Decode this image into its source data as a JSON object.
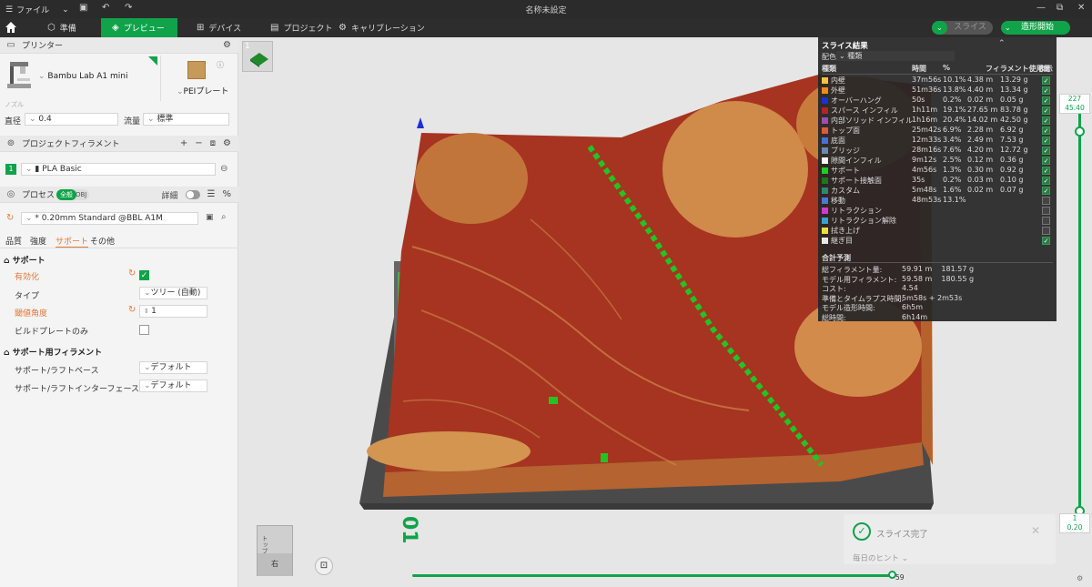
{
  "titlebar": {
    "file_menu": "ファイル",
    "title": "名称未設定"
  },
  "tabs": [
    {
      "label": "準備"
    },
    {
      "label": "プレビュー"
    },
    {
      "label": "デバイス"
    },
    {
      "label": "プロジェクト"
    },
    {
      "label": "キャリブレーション"
    }
  ],
  "actions": {
    "slice": "スライス",
    "print": "造形開始"
  },
  "printer": {
    "section": "プリンター",
    "name": "Bambu Lab A1 mini",
    "plate": "PEIプレート",
    "nozzle_label": "ノズル",
    "diameter_label": "直径",
    "diameter_value": "0.4",
    "flow_label": "流量",
    "flow_value": "標準"
  },
  "filament": {
    "section": "プロジェクトフィラメント",
    "index": "1",
    "name": "PLA Basic"
  },
  "process": {
    "section": "プロセス",
    "toggle_all": "全般",
    "toggle_obj": "OBJ",
    "detail_label": "詳細",
    "profile": "* 0.20mm Standard @BBL A1M",
    "subtabs": [
      "品質",
      "強度",
      "サポート",
      "その他"
    ]
  },
  "support": {
    "group": "サポート",
    "enable_label": "有効化",
    "type_label": "タイプ",
    "type_value": "ツリー (自動)",
    "threshold_label": "閾値角度",
    "threshold_value": "1",
    "buildplate_label": "ビルドプレートのみ",
    "filament_group": "サポート用フィラメント",
    "base_label": "サポート/ラフトベース",
    "base_value": "デフォルト",
    "interface_label": "サポート/ラフトインターフェース",
    "interface_value": "デフォルト"
  },
  "plate_thumb": {
    "number": "1"
  },
  "plate_label": "01",
  "layer_slider": {
    "top_layer": "227",
    "top_height": "45.40",
    "bottom_layer": "1",
    "bottom_height": "0.20"
  },
  "horizontal_slider": {
    "value": "59"
  },
  "cube_labels": {
    "top": "トップ",
    "right": "右"
  },
  "slice_result": {
    "title": "スライス結果",
    "color_scheme_label": "配色",
    "color_scheme_value": "種類",
    "headers": [
      "種類",
      "時間",
      "%",
      "フィラメント使用量",
      "表示"
    ],
    "rows": [
      {
        "name": "内壁",
        "color": "#f2c53d",
        "time": "37m56s",
        "pct": "10.1%",
        "len": "4.38 m",
        "weight": "13.29 g",
        "visible": true
      },
      {
        "name": "外壁",
        "color": "#f08a1c",
        "time": "51m36s",
        "pct": "13.8%",
        "len": "4.40 m",
        "weight": "13.34 g",
        "visible": true
      },
      {
        "name": "オーバーハング",
        "color": "#1e2fd6",
        "time": "50s",
        "pct": "0.2%",
        "len": "0.02 m",
        "weight": "0.05 g",
        "visible": true
      },
      {
        "name": "スパース インフィル",
        "color": "#b02525",
        "time": "1h11m",
        "pct": "19.1%",
        "len": "27.65 m",
        "weight": "83.78 g",
        "visible": true
      },
      {
        "name": "内部ソリッド インフィル",
        "color": "#9b4fb5",
        "time": "1h16m",
        "pct": "20.4%",
        "len": "14.02 m",
        "weight": "42.50 g",
        "visible": true
      },
      {
        "name": "トップ面",
        "color": "#e05a3a",
        "time": "25m42s",
        "pct": "6.9%",
        "len": "2.28 m",
        "weight": "6.92 g",
        "visible": true
      },
      {
        "name": "底面",
        "color": "#4a6fd6",
        "time": "12m33s",
        "pct": "3.4%",
        "len": "2.49 m",
        "weight": "7.53 g",
        "visible": true
      },
      {
        "name": "ブリッジ",
        "color": "#6a8ab0",
        "time": "28m16s",
        "pct": "7.6%",
        "len": "4.20 m",
        "weight": "12.72 g",
        "visible": true
      },
      {
        "name": "隙間インフィル",
        "color": "#ffffff",
        "time": "9m12s",
        "pct": "2.5%",
        "len": "0.12 m",
        "weight": "0.36 g",
        "visible": true
      },
      {
        "name": "サポート",
        "color": "#22cc22",
        "time": "4m56s",
        "pct": "1.3%",
        "len": "0.30 m",
        "weight": "0.92 g",
        "visible": true
      },
      {
        "name": "サポート接触面",
        "color": "#1a7a1a",
        "time": "35s",
        "pct": "0.2%",
        "len": "0.03 m",
        "weight": "0.10 g",
        "visible": true
      },
      {
        "name": "カスタム",
        "color": "#2a8a6a",
        "time": "5m48s",
        "pct": "1.6%",
        "len": "0.02 m",
        "weight": "0.07 g",
        "visible": true
      },
      {
        "name": "移動",
        "color": "#4a7ad0",
        "time": "48m53s",
        "pct": "13.1%",
        "len": "",
        "weight": "",
        "visible": false
      },
      {
        "name": "リトラクション",
        "color": "#d03ad0",
        "time": "",
        "pct": "",
        "len": "",
        "weight": "",
        "visible": false
      },
      {
        "name": "リトラクション解除",
        "color": "#3aa0d0",
        "time": "",
        "pct": "",
        "len": "",
        "weight": "",
        "visible": false
      },
      {
        "name": "拭き上げ",
        "color": "#e8e040",
        "time": "",
        "pct": "",
        "len": "",
        "weight": "",
        "visible": false
      },
      {
        "name": "継ぎ目",
        "color": "#e8e8e8",
        "time": "",
        "pct": "",
        "len": "",
        "weight": "",
        "visible": true
      }
    ],
    "summary_title": "合計予測",
    "summary": [
      {
        "label": "総フィラメント量:",
        "value": "59.91 m    181.57 g"
      },
      {
        "label": "モデル用フィラメント:",
        "value": "59.58 m    180.55 g"
      },
      {
        "label": "コスト:",
        "value": "4.54"
      },
      {
        "label": "準備とタイムラプス時間:",
        "value": "5m58s + 2m53s"
      },
      {
        "label": "モデル造形時間:",
        "value": "6h5m"
      },
      {
        "label": "総時間:",
        "value": "6h14m"
      }
    ]
  },
  "notice": {
    "title": "スライス完了",
    "hint": "毎日のヒント"
  }
}
